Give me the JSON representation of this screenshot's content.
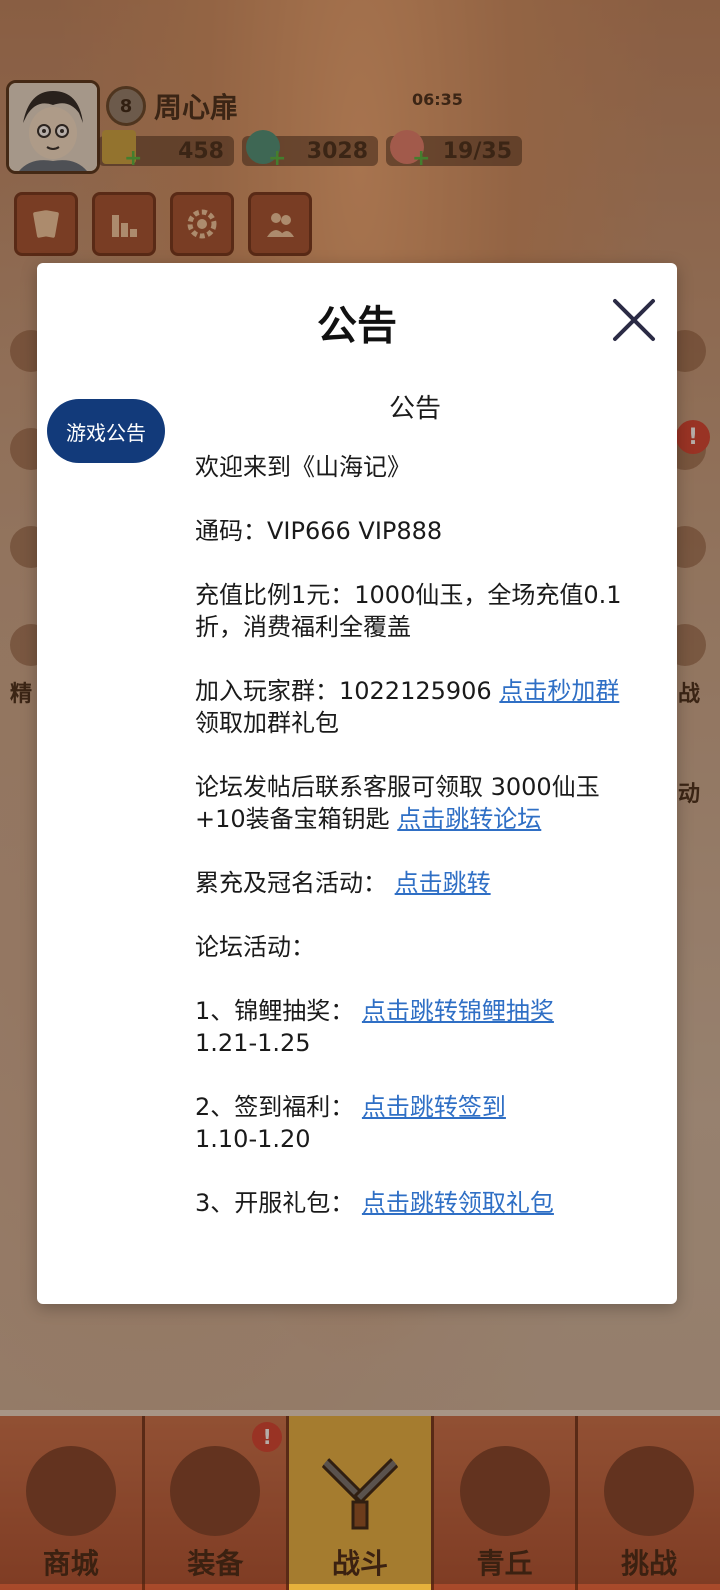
{
  "player": {
    "level": "8",
    "name": "周心扉",
    "coins": "458",
    "jade": "3028",
    "stamina": "19/35",
    "stamina_timer": "06:35"
  },
  "side": {
    "left_label": "精",
    "right_label_1": "战",
    "right_label_2": "动"
  },
  "nav": {
    "items": [
      {
        "label": "商城"
      },
      {
        "label": "装备"
      },
      {
        "label": "战斗"
      },
      {
        "label": "青丘"
      },
      {
        "label": "挑战"
      }
    ]
  },
  "dialog": {
    "title": "公告",
    "tab_label": "游戏公告",
    "content_title": "公告",
    "welcome": "欢迎来到《山海记》",
    "code": "通码：VIP666 VIP888",
    "recharge": "充值比例1元：1000仙玉，全场充值0.1折，消费福利全覆盖",
    "group_prefix": "加入玩家群：1022125906 ",
    "group_link": "点击秒加群",
    "group_suffix": " 领取加群礼包",
    "forum_prefix": "论坛发帖后联系客服可领取 3000仙玉+10装备宝箱钥匙 ",
    "forum_link": "点击跳转论坛",
    "event_prefix": "累充及冠名活动： ",
    "event_link": "点击跳转",
    "forum_activity": "论坛活动：",
    "act1_prefix": "1、锦鲤抽奖： ",
    "act1_link": "点击跳转锦鲤抽奖",
    "act1_date": "1.21-1.25",
    "act2_prefix": "2、签到福利： ",
    "act2_link": "点击跳转签到",
    "act2_date": "1.10-1.20",
    "act3_prefix": "3、开服礼包： ",
    "act3_link": "点击跳转领取礼包"
  },
  "colors": {
    "tab_bg": "#123a7a",
    "link": "#2f6fc5",
    "nav_active": "#e6b13c"
  }
}
